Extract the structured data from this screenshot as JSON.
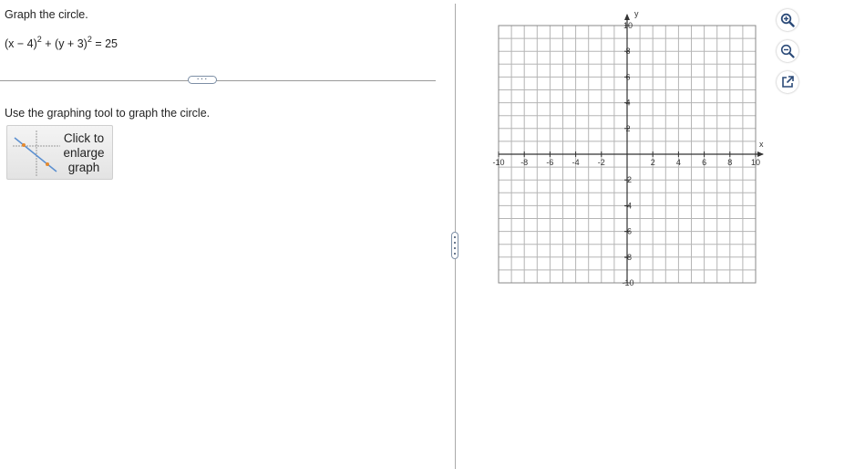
{
  "question": {
    "prompt": "Graph the circle.",
    "equation": {
      "part1": "(x − 4)",
      "exp1": "2",
      "part2": " + (y + 3)",
      "exp2": "2",
      "part3": " = 25"
    },
    "instruction": "Use the graphing tool to graph the circle."
  },
  "divider": {
    "ellipsis": "···"
  },
  "enlarge_button": {
    "line1": "Click to",
    "line2": "enlarge",
    "line3": "graph"
  },
  "graph": {
    "x_axis_label": "x",
    "y_axis_label": "y",
    "xlim": [
      -10,
      10
    ],
    "ylim": [
      -10,
      10
    ],
    "grid_step": 1,
    "x_ticks": [
      {
        "value": -10,
        "label": "-10"
      },
      {
        "value": -8,
        "label": "-8"
      },
      {
        "value": -6,
        "label": "-6"
      },
      {
        "value": -4,
        "label": "-4"
      },
      {
        "value": -2,
        "label": "-2"
      },
      {
        "value": 2,
        "label": "2"
      },
      {
        "value": 4,
        "label": "4"
      },
      {
        "value": 6,
        "label": "6"
      },
      {
        "value": 8,
        "label": "8"
      },
      {
        "value": 10,
        "label": "10"
      }
    ],
    "y_ticks": [
      {
        "value": 10,
        "label": "10"
      },
      {
        "value": 8,
        "label": "8"
      },
      {
        "value": 6,
        "label": "6"
      },
      {
        "value": 4,
        "label": "4"
      },
      {
        "value": 2,
        "label": "2"
      },
      {
        "value": -2,
        "label": "-2"
      },
      {
        "value": -4,
        "label": "-4"
      },
      {
        "value": -6,
        "label": "-6"
      },
      {
        "value": -8,
        "label": "-8"
      },
      {
        "value": -10,
        "label": "-10"
      }
    ]
  },
  "tools": [
    {
      "name": "zoom-in-icon"
    },
    {
      "name": "zoom-out-icon"
    },
    {
      "name": "popout-icon"
    }
  ],
  "colors": {
    "accent": "#2b4a78",
    "grid": "#b5b5b5",
    "axis": "#333333"
  }
}
